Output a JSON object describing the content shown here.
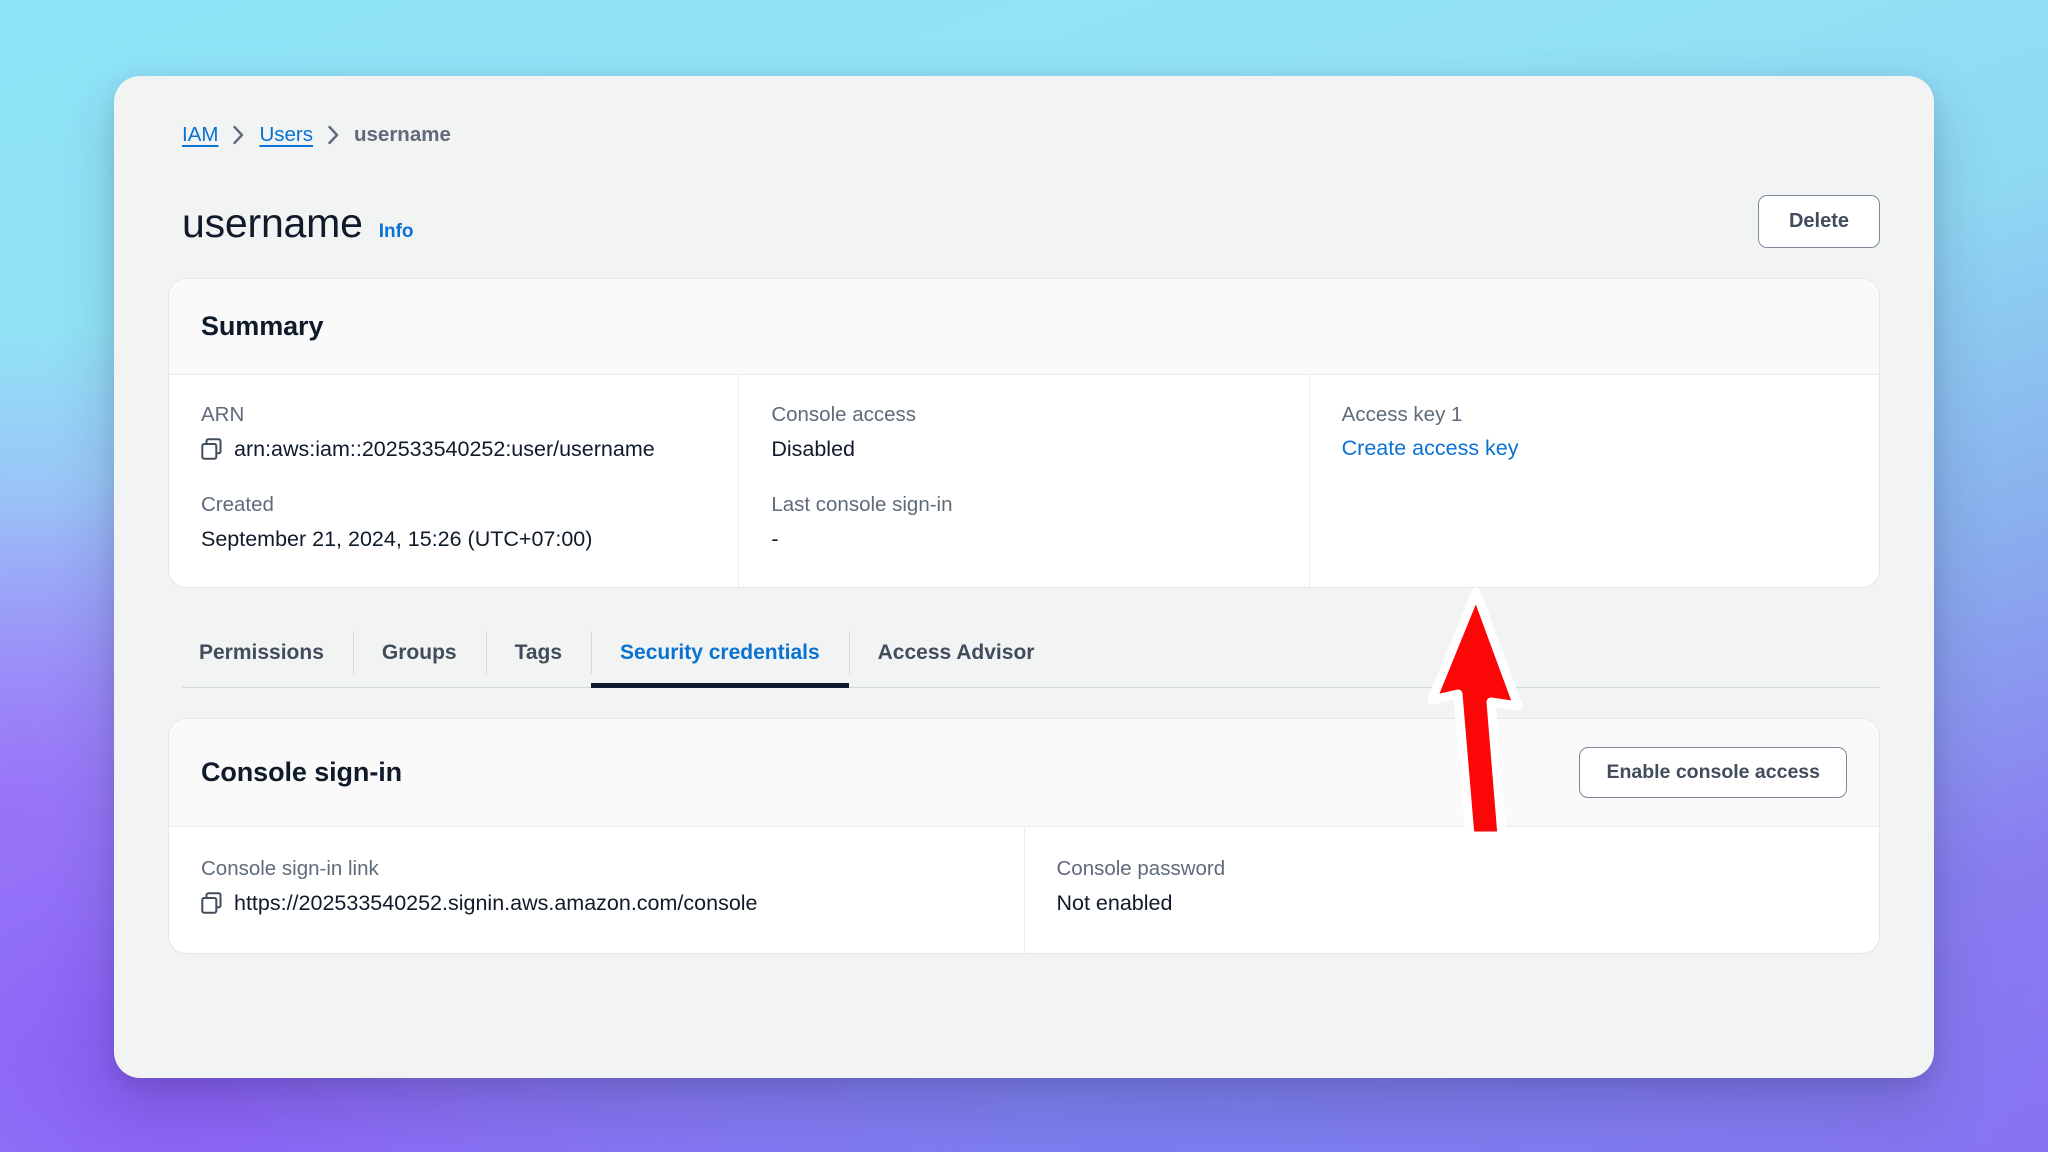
{
  "breadcrumb": {
    "items": [
      {
        "label": "IAM",
        "type": "link"
      },
      {
        "label": "Users",
        "type": "link"
      },
      {
        "label": "username",
        "type": "current"
      }
    ]
  },
  "header": {
    "title": "username",
    "info_label": "Info",
    "delete_label": "Delete"
  },
  "summary": {
    "title": "Summary",
    "columns": [
      {
        "fields": [
          {
            "label": "ARN",
            "value": "arn:aws:iam::202533540252:user/username",
            "icon": "copy-icon"
          },
          {
            "label": "Created",
            "value": "September 21, 2024, 15:26 (UTC+07:00)"
          }
        ]
      },
      {
        "fields": [
          {
            "label": "Console access",
            "value": "Disabled"
          },
          {
            "label": "Last console sign-in",
            "value": "-"
          }
        ]
      },
      {
        "fields": [
          {
            "label": "Access key 1",
            "link": "Create access key"
          }
        ]
      }
    ]
  },
  "tabs": [
    {
      "label": "Permissions",
      "active": false
    },
    {
      "label": "Groups",
      "active": false
    },
    {
      "label": "Tags",
      "active": false
    },
    {
      "label": "Security credentials",
      "active": true
    },
    {
      "label": "Access Advisor",
      "active": false
    }
  ],
  "console_signin": {
    "title": "Console sign-in",
    "enable_label": "Enable console access",
    "fields": [
      {
        "label": "Console sign-in link",
        "value": "https://202533540252.signin.aws.amazon.com/console",
        "icon": "copy-icon"
      },
      {
        "label": "Console password",
        "value": "Not enabled"
      }
    ]
  },
  "annotation": {
    "type": "arrow-up",
    "color": "#fb0707",
    "outline": "#ffffff",
    "points_at": "Create access key"
  },
  "colors": {
    "accent_link": "#0972d3",
    "text_dark": "#0f1b2a",
    "text_muted": "#5f6b7a",
    "panel_bg": "#f2f3f3",
    "card_bg": "#ffffff",
    "annotation_red": "#fb0707"
  }
}
